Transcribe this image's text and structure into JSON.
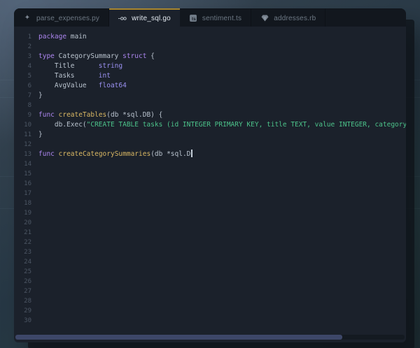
{
  "tabs": [
    {
      "label": "parse_expenses.py",
      "icon": "python-file-icon",
      "active": false
    },
    {
      "label": "write_sql.go",
      "icon": "go-file-icon",
      "active": true
    },
    {
      "label": "sentiment.ts",
      "icon": "typescript-file-icon",
      "active": false
    },
    {
      "label": "addresses.rb",
      "icon": "ruby-file-icon",
      "active": false
    }
  ],
  "editor": {
    "language": "go",
    "total_lines": 30,
    "cursor_line": 13,
    "lines": [
      {
        "n": 1,
        "tokens": [
          {
            "t": "package",
            "c": "kw"
          },
          {
            "t": " main",
            "c": "fg"
          }
        ]
      },
      {
        "n": 2,
        "tokens": []
      },
      {
        "n": 3,
        "tokens": [
          {
            "t": "type",
            "c": "kw"
          },
          {
            "t": " CategorySummary ",
            "c": "fg"
          },
          {
            "t": "struct",
            "c": "kw"
          },
          {
            "t": " {",
            "c": "fg"
          }
        ]
      },
      {
        "n": 4,
        "tokens": [
          {
            "t": "    Title      ",
            "c": "fg"
          },
          {
            "t": "string",
            "c": "ty"
          }
        ]
      },
      {
        "n": 5,
        "tokens": [
          {
            "t": "    Tasks      ",
            "c": "fg"
          },
          {
            "t": "int",
            "c": "ty"
          }
        ]
      },
      {
        "n": 6,
        "tokens": [
          {
            "t": "    AvgValue   ",
            "c": "fg"
          },
          {
            "t": "float64",
            "c": "ty"
          }
        ]
      },
      {
        "n": 7,
        "tokens": [
          {
            "t": "}",
            "c": "fg"
          }
        ]
      },
      {
        "n": 8,
        "tokens": []
      },
      {
        "n": 9,
        "tokens": [
          {
            "t": "func",
            "c": "kw"
          },
          {
            "t": " ",
            "c": "fg"
          },
          {
            "t": "createTables",
            "c": "fn"
          },
          {
            "t": "(db *sql.DB) {",
            "c": "fg"
          }
        ]
      },
      {
        "n": 10,
        "tokens": [
          {
            "t": "    db.Exec(",
            "c": "fg"
          },
          {
            "t": "\"CREATE TABLE tasks (id INTEGER PRIMARY KEY, title TEXT, value INTEGER, category TEXT",
            "c": "str"
          }
        ]
      },
      {
        "n": 11,
        "tokens": [
          {
            "t": "}",
            "c": "fg"
          }
        ]
      },
      {
        "n": 12,
        "tokens": []
      },
      {
        "n": 13,
        "tokens": [
          {
            "t": "func",
            "c": "kw"
          },
          {
            "t": " ",
            "c": "fg"
          },
          {
            "t": "createCategorySummaries",
            "c": "fn"
          },
          {
            "t": "(db *sql.D",
            "c": "fg"
          }
        ]
      },
      {
        "n": 14,
        "tokens": []
      },
      {
        "n": 15,
        "tokens": []
      },
      {
        "n": 16,
        "tokens": []
      },
      {
        "n": 17,
        "tokens": []
      },
      {
        "n": 18,
        "tokens": []
      },
      {
        "n": 19,
        "tokens": []
      },
      {
        "n": 20,
        "tokens": []
      },
      {
        "n": 21,
        "tokens": []
      },
      {
        "n": 22,
        "tokens": []
      },
      {
        "n": 23,
        "tokens": []
      },
      {
        "n": 24,
        "tokens": []
      },
      {
        "n": 25,
        "tokens": []
      },
      {
        "n": 26,
        "tokens": []
      },
      {
        "n": 27,
        "tokens": []
      },
      {
        "n": 28,
        "tokens": []
      },
      {
        "n": 29,
        "tokens": []
      },
      {
        "n": 30,
        "tokens": []
      }
    ]
  },
  "scrollbar": {
    "orientation": "horizontal",
    "thumb_ratio": 0.84
  },
  "colors": {
    "page_bg_top": "#425061",
    "page_bg_bottom": "#203138",
    "panel_bg": "#1b212b",
    "tabbar_bg": "#12171e",
    "active_tab_accent": "#a8862e",
    "keyword": "#ab85ee",
    "type": "#9b91f2",
    "function": "#d9b763",
    "string": "#4cc38a",
    "foreground": "#b9c3ce",
    "line_number": "#4c5664",
    "scrollbar_thumb": "#3d4768"
  }
}
